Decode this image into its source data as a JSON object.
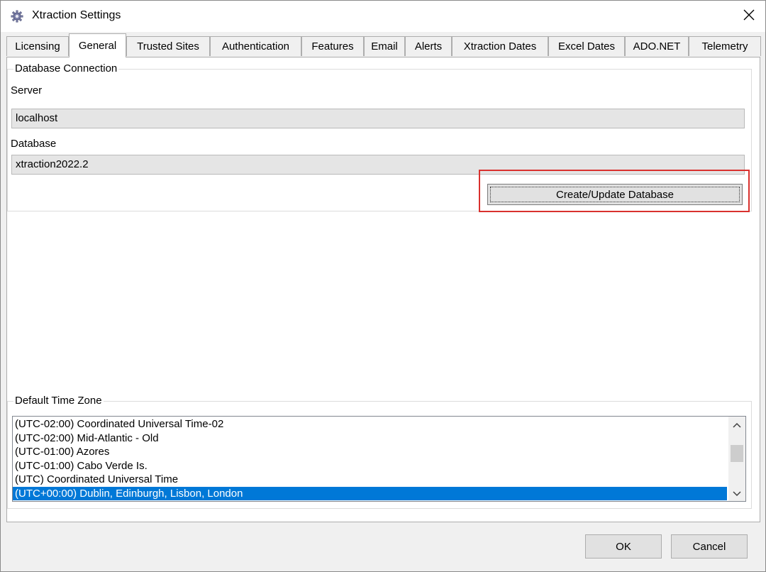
{
  "window": {
    "title": "Xtraction Settings",
    "icon": "gear-icon",
    "close_label": "✕"
  },
  "tabs": [
    {
      "label": "Licensing",
      "active": false
    },
    {
      "label": "General",
      "active": true
    },
    {
      "label": "Trusted Sites",
      "active": false
    },
    {
      "label": "Authentication",
      "active": false
    },
    {
      "label": "Features",
      "active": false
    },
    {
      "label": "Email",
      "active": false
    },
    {
      "label": "Alerts",
      "active": false
    },
    {
      "label": "Xtraction Dates",
      "active": false
    },
    {
      "label": "Excel Dates",
      "active": false
    },
    {
      "label": "ADO.NET",
      "active": false
    },
    {
      "label": "Telemetry",
      "active": false
    }
  ],
  "database_connection": {
    "legend": "Database Connection",
    "server_label": "Server",
    "server_value": "localhost",
    "database_label": "Database",
    "database_value": "xtraction2022.2",
    "create_button_label": "Create/Update Database"
  },
  "time_zone": {
    "legend": "Default Time Zone",
    "items": [
      {
        "label": "(UTC-02:00) Coordinated Universal Time-02",
        "selected": false
      },
      {
        "label": "(UTC-02:00) Mid-Atlantic - Old",
        "selected": false
      },
      {
        "label": "(UTC-01:00) Azores",
        "selected": false
      },
      {
        "label": "(UTC-01:00) Cabo Verde Is.",
        "selected": false
      },
      {
        "label": "(UTC) Coordinated Universal Time",
        "selected": false
      },
      {
        "label": "(UTC+00:00) Dublin, Edinburgh, Lisbon, London",
        "selected": true
      }
    ]
  },
  "footer": {
    "ok_label": "OK",
    "cancel_label": "Cancel"
  },
  "colors": {
    "selection": "#0078d7",
    "highlight": "#d9312e"
  }
}
